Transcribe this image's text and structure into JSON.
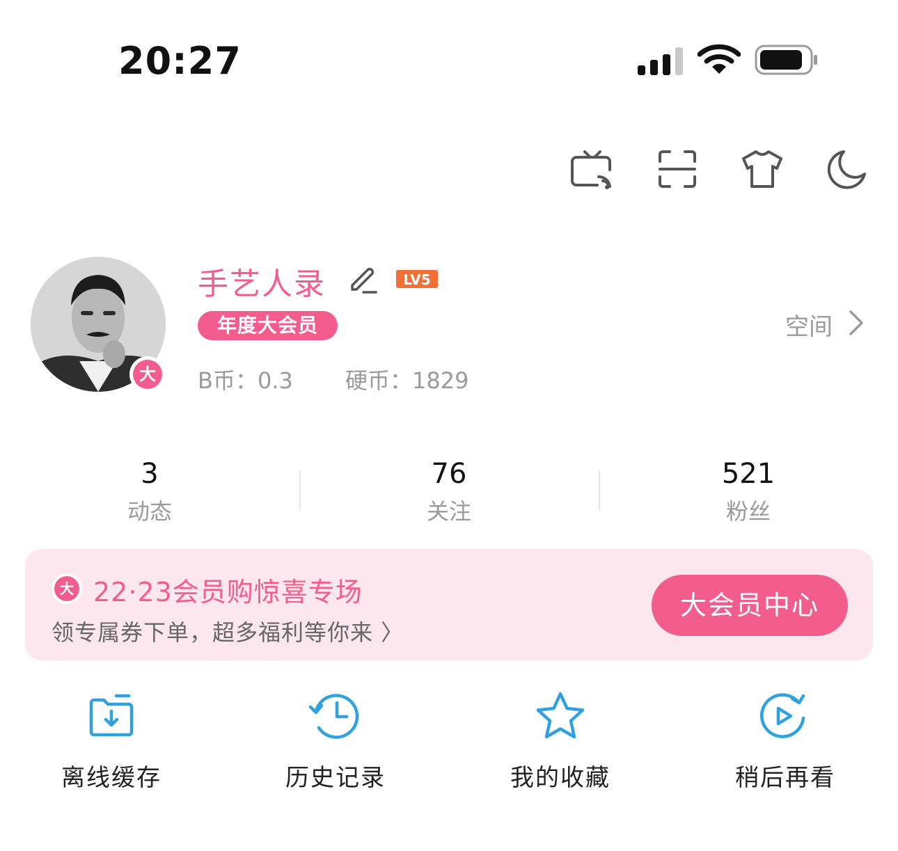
{
  "status_bar": {
    "time": "20:27"
  },
  "toolbar": {
    "icons": [
      "cast-tv-icon",
      "scan-icon",
      "theme-shirt-icon",
      "night-mode-moon-icon"
    ]
  },
  "profile": {
    "username": "手艺人录",
    "level_badge": "LV5",
    "vip_label": "年度大会员",
    "avatar_badge": "大",
    "b_coin": "B币：0.3",
    "coins": "硬币：1829",
    "space_link": "空间"
  },
  "stats": [
    {
      "value": "3",
      "label": "动态"
    },
    {
      "value": "76",
      "label": "关注"
    },
    {
      "value": "521",
      "label": "粉丝"
    }
  ],
  "vip_banner": {
    "icon_text": "大",
    "title": "22·23会员购惊喜专场",
    "subtitle": "领专属券下单，超多福利等你来 〉",
    "button": "大会员中心"
  },
  "quick_actions": [
    {
      "label": "离线缓存",
      "icon": "offline-download-icon"
    },
    {
      "label": "历史记录",
      "icon": "history-clock-icon"
    },
    {
      "label": "我的收藏",
      "icon": "favorite-star-icon"
    },
    {
      "label": "稍后再看",
      "icon": "watch-later-icon"
    }
  ],
  "colors": {
    "accent": "#f25d8e",
    "blue_icon": "#2fa0e0",
    "muted_text": "#9a9a9a",
    "banner_bg": "#fde7ee"
  }
}
